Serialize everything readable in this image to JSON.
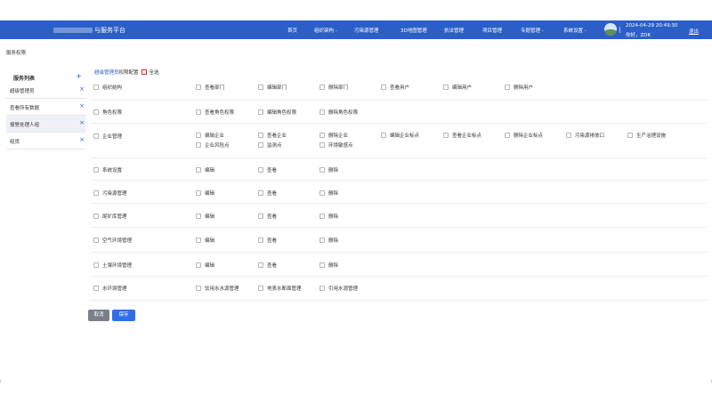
{
  "header": {
    "title": "与服务平台",
    "nav": [
      "首页",
      "组织架构 -",
      "污染源管理",
      "3D地图管理",
      "执法管理",
      "项目管理",
      "专题管理 -",
      "系统设置 -"
    ],
    "datetime": "2024-04-29 20:49:30",
    "greeting": "你好，ZDK",
    "logout": "退出"
  },
  "breadcrumb": "服务权限",
  "sidebar": {
    "title": "服务列表",
    "add_icon": "+",
    "remove_icon": "×",
    "items": [
      "超级管理员",
      "查看所有数据",
      "报警处理人组",
      "组员"
    ],
    "active_index": 2
  },
  "permission_header": {
    "role": "超级管理员",
    "suffix": "权限配置",
    "select_all": "全选"
  },
  "modules": [
    {
      "name": "组织结构",
      "perms": [
        "查看部门",
        "编辑部门",
        "删除部门",
        "查看用户",
        "编辑用户",
        "删除用户"
      ]
    },
    {
      "name": "角色权限",
      "perms": [
        "查看角色权限",
        "编辑角色权限",
        "删除角色权限"
      ]
    },
    {
      "name": "企业管理",
      "perms": [
        "编辑企业",
        "查看企业",
        "删除企业",
        "编辑企业标点",
        "查看企业标点",
        "删除企业标点",
        "污染源排放口",
        "生产治理设施",
        "企业风险点",
        "监测点",
        "环境敏感点"
      ]
    },
    {
      "name": "系统设置",
      "perms": [
        "编辑",
        "查看",
        "删除"
      ]
    },
    {
      "name": "污染源管理",
      "perms": [
        "编辑",
        "查看",
        "删除"
      ]
    },
    {
      "name": "尾矿库管理",
      "perms": [
        "编辑",
        "查看",
        "删除"
      ]
    },
    {
      "name": "空气环境管理",
      "perms": [
        "编辑",
        "查看",
        "删除"
      ]
    },
    {
      "name": "土壤环境管理",
      "perms": [
        "编辑",
        "查看",
        "删除"
      ]
    },
    {
      "name": "水环境管理",
      "perms": [
        "饮用水水源管理",
        "地表水断面管理",
        "引用水源管理"
      ]
    }
  ],
  "actions": {
    "cancel": "取消",
    "save": "保存"
  }
}
